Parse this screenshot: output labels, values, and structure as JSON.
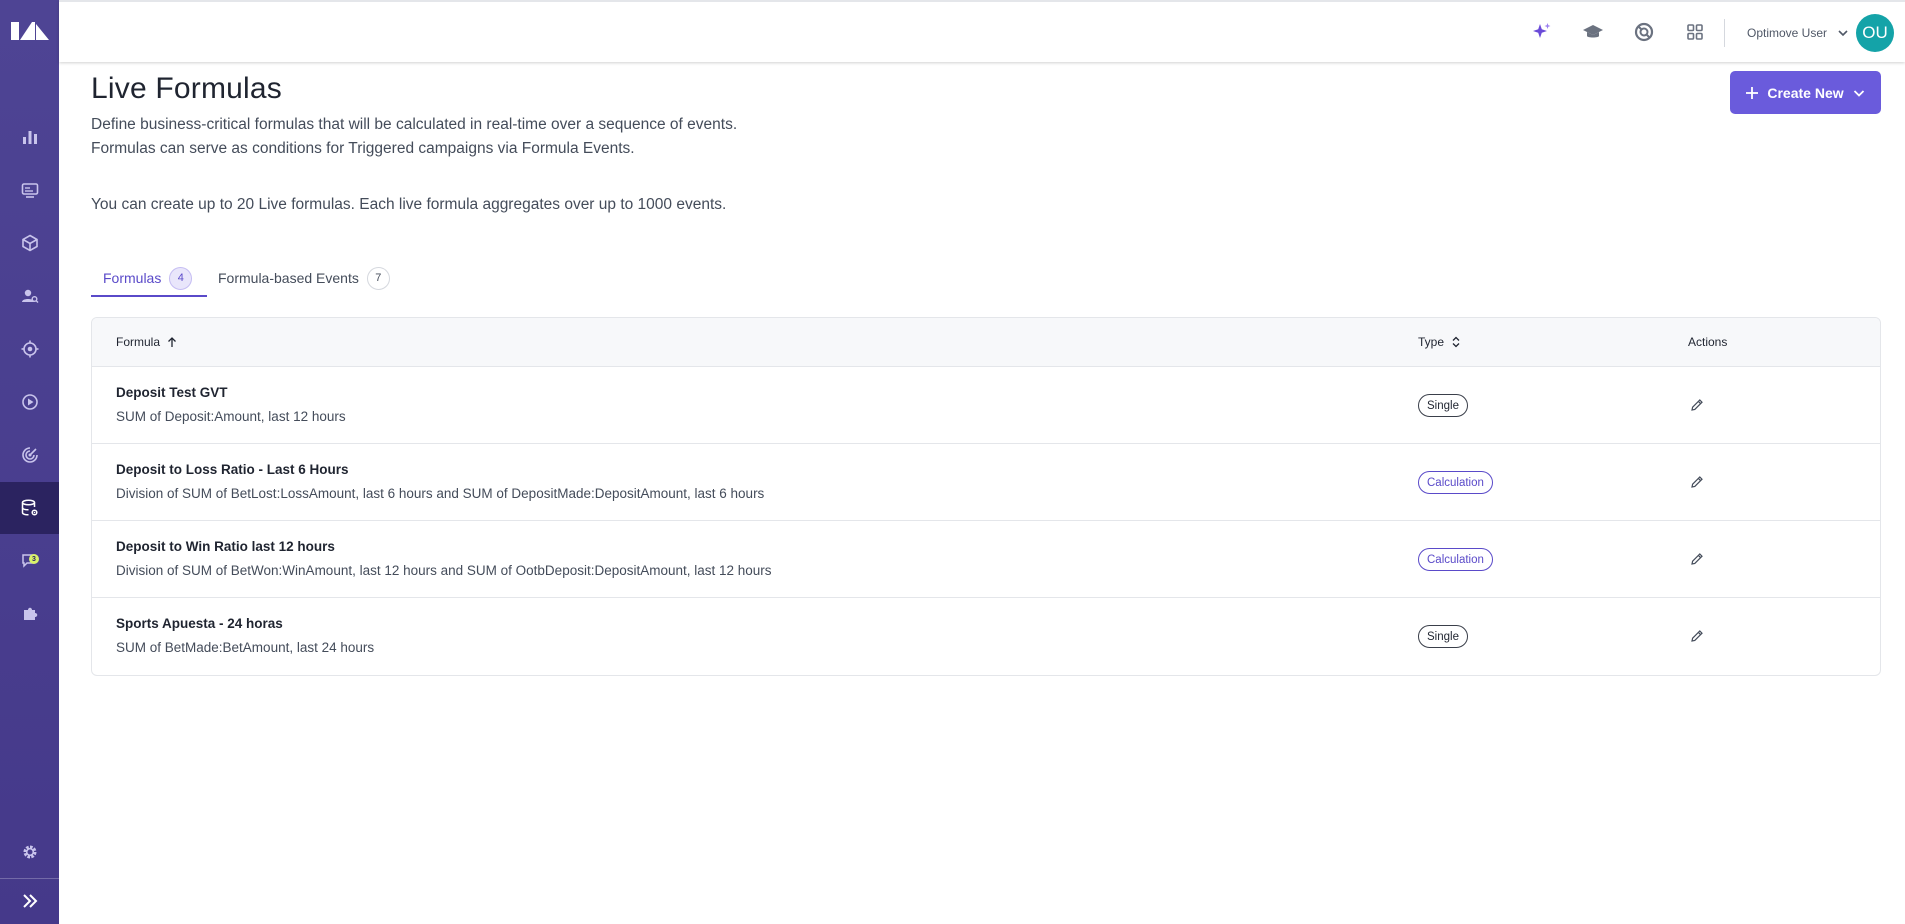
{
  "header": {
    "user_name": "Optimove User",
    "avatar_initials": "OU",
    "icons": [
      "sparkle-icon",
      "academy-icon",
      "support-icon",
      "apps-grid-icon"
    ]
  },
  "sidebar": {
    "items": [
      {
        "icon": "bar-chart-icon"
      },
      {
        "icon": "monitor-icon"
      },
      {
        "icon": "cube-icon"
      },
      {
        "icon": "user-search-icon"
      },
      {
        "icon": "target-icon"
      },
      {
        "icon": "play-icon"
      },
      {
        "icon": "radar-icon"
      },
      {
        "icon": "database-settings-icon",
        "active": true
      },
      {
        "icon": "chat-badge-icon",
        "badge": "3"
      },
      {
        "icon": "puzzle-icon"
      },
      {
        "icon": "gear-icon"
      },
      {
        "icon": "expand-icon"
      }
    ]
  },
  "page": {
    "title": "Live Formulas",
    "desc_line1": "Define business-critical formulas that will be calculated in real-time over a sequence of events.",
    "desc_line2": "Formulas can serve as conditions for Triggered campaigns via Formula Events.",
    "desc_line3": "You can create up to 20 Live formulas. Each live formula aggregates over up to 1000 events.",
    "create_label": "Create New"
  },
  "tabs": [
    {
      "label": "Formulas",
      "count": "4",
      "active": true
    },
    {
      "label": "Formula-based Events",
      "count": "7",
      "active": false
    }
  ],
  "table": {
    "columns": {
      "formula": "Formula",
      "type": "Type",
      "actions": "Actions"
    },
    "rows": [
      {
        "name": "Deposit Test GVT",
        "desc": "SUM of Deposit:Amount, last 12 hours",
        "type": "Single"
      },
      {
        "name": "Deposit to Loss Ratio - Last 6 Hours",
        "desc": "Division of SUM of BetLost:LossAmount, last 6 hours and SUM of DepositMade:DepositAmount, last 6 hours",
        "type": "Calculation"
      },
      {
        "name": "Deposit to Win Ratio last 12 hours",
        "desc": "Division of SUM of BetWon:WinAmount, last 12 hours and SUM of OotbDeposit:DepositAmount, last 12 hours",
        "type": "Calculation"
      },
      {
        "name": "Sports Apuesta - 24 horas",
        "desc": "SUM of BetMade:BetAmount, last 24 hours",
        "type": "Single"
      }
    ]
  },
  "colors": {
    "sidebar": "#4a3f8c",
    "accent": "#6a5bdc",
    "avatar": "#14a3a8"
  }
}
